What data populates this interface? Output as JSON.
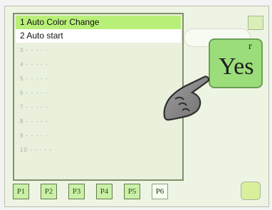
{
  "list": {
    "items": [
      {
        "label": "1 Auto Color Change"
      },
      {
        "label": "2 Auto start"
      },
      {
        "label": "3 - - - - -"
      },
      {
        "label": "4 - - - - -"
      },
      {
        "label": "5 - - - - -"
      },
      {
        "label": "6 - - - - -"
      },
      {
        "label": "7 - - - - -"
      },
      {
        "label": "8 - - - - -"
      },
      {
        "label": "9 - - - - -"
      },
      {
        "label": "10 - - - - -"
      }
    ]
  },
  "tabs": [
    {
      "label": "P1"
    },
    {
      "label": "P2"
    },
    {
      "label": "P3"
    },
    {
      "label": "P4"
    },
    {
      "label": "P5"
    },
    {
      "label": "P6"
    }
  ],
  "confirm": {
    "yes_label": "Yes",
    "r_label": "r"
  },
  "icons": {
    "pointer": "hand-pointer-icon"
  },
  "colors": {
    "selected_row": "#b8ef78",
    "tab_bg": "#c9f0a6",
    "yes_bg": "#9bdd7a"
  }
}
